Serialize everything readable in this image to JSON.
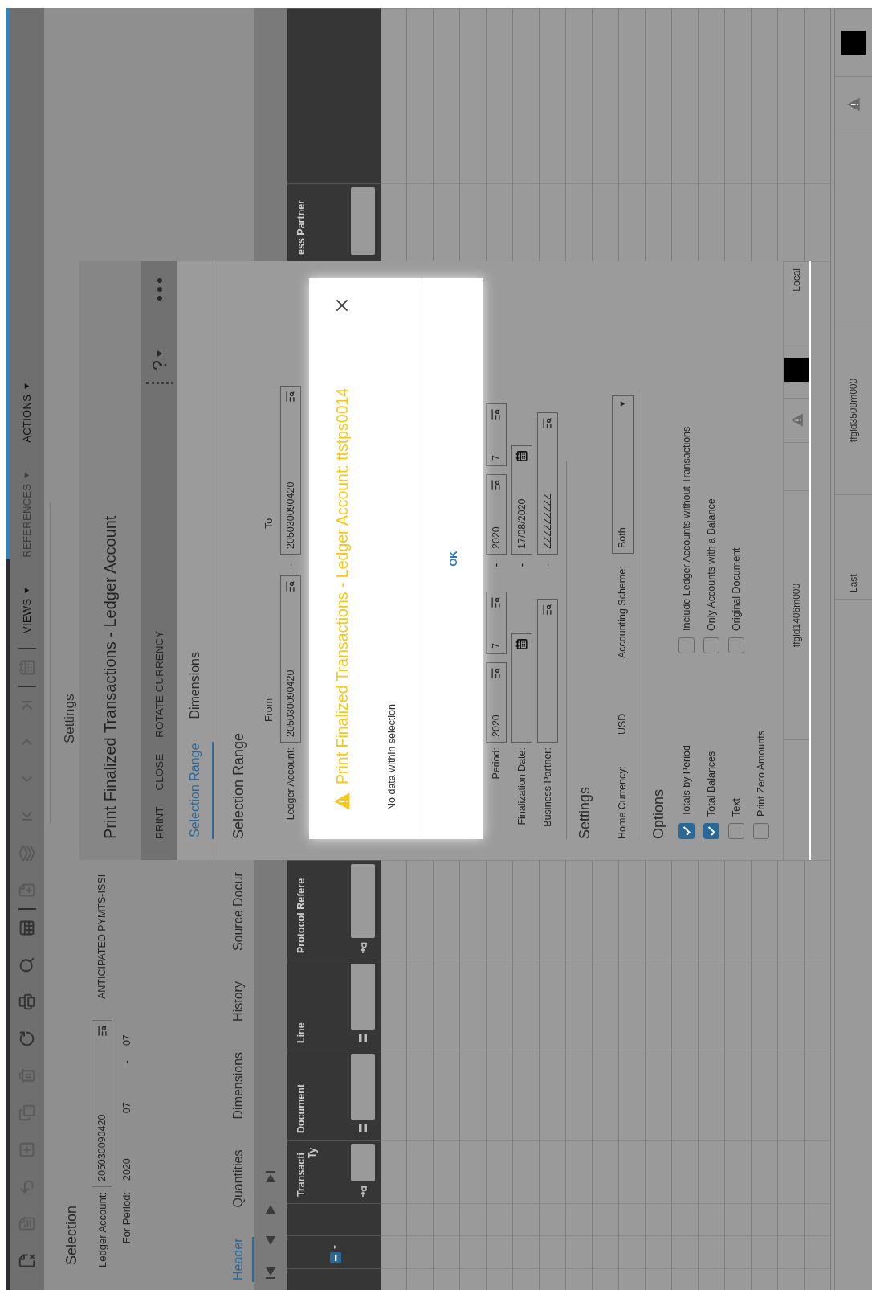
{
  "toolbar": {
    "groups": [
      [
        {
          "kind": "clear",
          "disabled": false
        },
        {
          "kind": "form",
          "disabled": true
        },
        {
          "kind": "undo",
          "disabled": true
        },
        {
          "kind": "new",
          "disabled": true
        },
        {
          "kind": "duplicate",
          "disabled": true
        },
        {
          "kind": "delete",
          "disabled": true
        },
        {
          "kind": "refresh",
          "disabled": false
        },
        {
          "kind": "print",
          "disabled": false
        },
        {
          "kind": "search",
          "disabled": false
        },
        {
          "kind": "export",
          "disabled": false
        }
      ],
      [
        {
          "kind": "add-file",
          "disabled": true
        },
        {
          "kind": "stack",
          "disabled": true
        },
        {
          "kind": "first",
          "disabled": true
        },
        {
          "kind": "previous",
          "disabled": true
        },
        {
          "kind": "next",
          "disabled": true
        },
        {
          "kind": "last",
          "disabled": true
        }
      ],
      [
        {
          "kind": "calendar",
          "disabled": true
        }
      ]
    ],
    "menus": [
      {
        "label": "VIEWS",
        "disabled": false
      },
      {
        "label": "REFERENCES",
        "disabled": true
      },
      {
        "label": "ACTIONS",
        "disabled": false
      }
    ]
  },
  "selection": {
    "title": "Selection",
    "ledger_account": {
      "label": "Ledger Account:",
      "value": "205030090420",
      "description": "ANTICIPATED PYMTS-ISSI"
    },
    "period": {
      "label": "For Period:",
      "year": "2020",
      "from": "07",
      "separator": "-",
      "to": "07"
    }
  },
  "tabs": [
    {
      "label": "Header",
      "selected": true
    },
    {
      "label": "Quantities",
      "selected": false
    },
    {
      "label": "Dimensions",
      "selected": false
    },
    {
      "label": "History",
      "selected": false
    },
    {
      "label": "Source Docur",
      "selected": false
    }
  ],
  "grid": {
    "select_all": {
      "kind": "indeterminate"
    },
    "columns": [
      {
        "label": "Transacti",
        "sublabel": "Ty",
        "kind": "text"
      },
      {
        "label": "Document",
        "kind": "equals"
      },
      {
        "label": "Line",
        "kind": "equals"
      },
      {
        "label": "Protocol Refere",
        "kind": "text"
      },
      {
        "label": "ess Partner",
        "kind": "input"
      }
    ]
  },
  "settings_panel": {
    "breadcrumb": "Settings",
    "title": "Print Finalized Transactions - Ledger Account",
    "actions": [
      "PRINT",
      "CLOSE",
      "ROTATE CURRENCY"
    ],
    "tabs": [
      {
        "label": "Selection Range",
        "selected": true
      },
      {
        "label": "Dimensions",
        "selected": false
      }
    ],
    "selection_range": {
      "heading": "Selection Range",
      "from_label": "From",
      "to_label": "To",
      "rows": [
        {
          "label": "Ledger Account:",
          "kind": "lookup",
          "from": "205030090420",
          "separator": "-",
          "to": "205030090420"
        },
        {
          "label": "Period:",
          "kind": "period",
          "from": [
            "2020",
            "7"
          ],
          "separator": "-",
          "to": [
            "2020",
            "7"
          ]
        },
        {
          "label": "Finalization Date:",
          "kind": "date",
          "separator": "-",
          "to": "17/08/2020"
        },
        {
          "label": "Business Partner:",
          "kind": "partner",
          "separator": "-",
          "to": "ZZZZZZZZZ"
        }
      ]
    },
    "settings": {
      "heading": "Settings",
      "home_currency": {
        "label": "Home Currency:",
        "value": "USD"
      },
      "accounting_scheme": {
        "label": "Accounting Scheme:",
        "value": "Both"
      }
    },
    "options": {
      "heading": "Options",
      "left": [
        {
          "label": "Totals by Period",
          "checked": true
        },
        {
          "label": "Total Balances",
          "checked": true
        },
        {
          "label": "Text",
          "checked": false
        },
        {
          "label": "Print Zero Amounts",
          "checked": false
        }
      ],
      "right": [
        {
          "label": "Include Ledger Accounts without Transactions",
          "checked": false
        },
        {
          "label": "Only Accounts with a Balance",
          "checked": false
        },
        {
          "label": "Original Document",
          "checked": false
        }
      ]
    },
    "status": {
      "session": "tfgld1406m000",
      "mode": "Local"
    }
  },
  "dialog": {
    "title": "Print Finalized Transactions - Ledger Account: ttstps0014",
    "message": "No data within selection",
    "button": "OK"
  },
  "status_bar": {
    "texts": [
      "Last",
      "tfgld3509m000"
    ]
  }
}
